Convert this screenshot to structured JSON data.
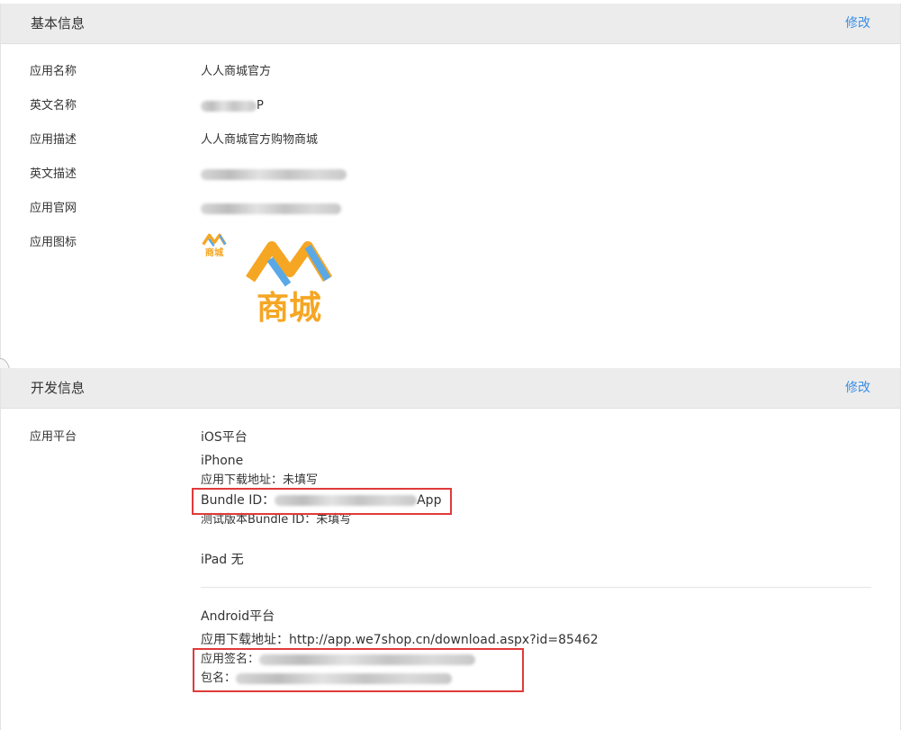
{
  "basic_info": {
    "title": "基本信息",
    "edit_label": "修改",
    "rows": [
      {
        "label": "应用名称",
        "value": "人人商城官方"
      },
      {
        "label": "英文名称",
        "value": "P"
      },
      {
        "label": "应用描述",
        "value": "人人商城官方购物商城"
      },
      {
        "label": "英文描述",
        "value": ""
      },
      {
        "label": "应用官网",
        "value": ""
      },
      {
        "label": "应用图标",
        "value": ""
      }
    ],
    "icon_text": "商城",
    "icon_color": "#f5a623"
  },
  "dev_info": {
    "title": "开发信息",
    "edit_label": "修改",
    "platform_label": "应用平台",
    "ios": {
      "title": "iOS平台",
      "device": "iPhone",
      "download": "应用下载地址：未填写",
      "bundle_prefix": "Bundle ID：",
      "bundle_suffix": "App",
      "test_bundle": "测试版本Bundle ID：未填写",
      "ipad": "iPad 无"
    },
    "android": {
      "title": "Android平台",
      "download": "应用下载地址：http://app.we7shop.cn/download.aspx?id=85462",
      "signature_prefix": "应用签名：",
      "package_prefix": "包名："
    }
  },
  "colors": {
    "link": "#3a8ee6",
    "highlight_box": "#e03a3a",
    "header_bg": "#ececec"
  }
}
